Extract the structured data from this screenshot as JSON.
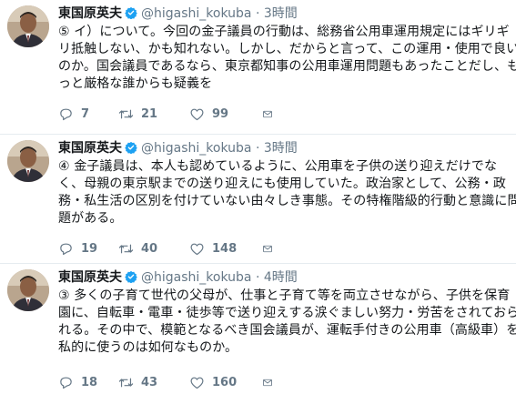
{
  "tweets": [
    {
      "name": "東国原英夫",
      "handle": "@higashi_kokuba",
      "dot": "·",
      "time": "3時間",
      "lines": [
        "⑤ イ）について。今回の金子議員の行動は、総務省公用車運用規定にはギリギ",
        "リ抵触しない、かも知れない。しかし、だからと言って、この運用・使用で良い",
        "のか。国会議員であるなら、東京都知事の公用車運用問題もあったことだし、も",
        "っと厳格な誰からも疑義を"
      ],
      "replies": "7",
      "retweets": "21",
      "likes": "99"
    },
    {
      "name": "東国原英夫",
      "handle": "@higashi_kokuba",
      "dot": "·",
      "time": "3時間",
      "lines": [
        "④ 金子議員は、本人も認めているように、公用車を子供の送り迎えだけでな",
        "く、母親の東京駅までの送り迎えにも使用していた。政治家として、公務・政",
        "務・私生活の区別を付けていない由々しき事態。その特権階級的行動と意識に問",
        "題がある。"
      ],
      "replies": "19",
      "retweets": "40",
      "likes": "148"
    },
    {
      "name": "東国原英夫",
      "handle": "@higashi_kokuba",
      "dot": "·",
      "time": "4時間",
      "lines": [
        "③ 多くの子育て世代の父母が、仕事と子育て等を両立させながら、子供を保育",
        "園に、自転車・電車・徒歩等で送り迎えする涙ぐましい努力・労苦をされておら",
        "れる。その中で、模範となるべき国会議員が、運転手付きの公用車（高級車）を",
        "私的に使うのは如何なものか。"
      ],
      "replies": "18",
      "retweets": "43",
      "likes": "160"
    }
  ],
  "colors": {
    "name": "#14171a",
    "meta": "#657786",
    "verified": "#1da1f2",
    "divider": "#e6ecf0"
  },
  "icons": [
    "verified-badge-icon",
    "reply-icon",
    "retweet-icon",
    "like-icon",
    "direct-message-icon"
  ]
}
